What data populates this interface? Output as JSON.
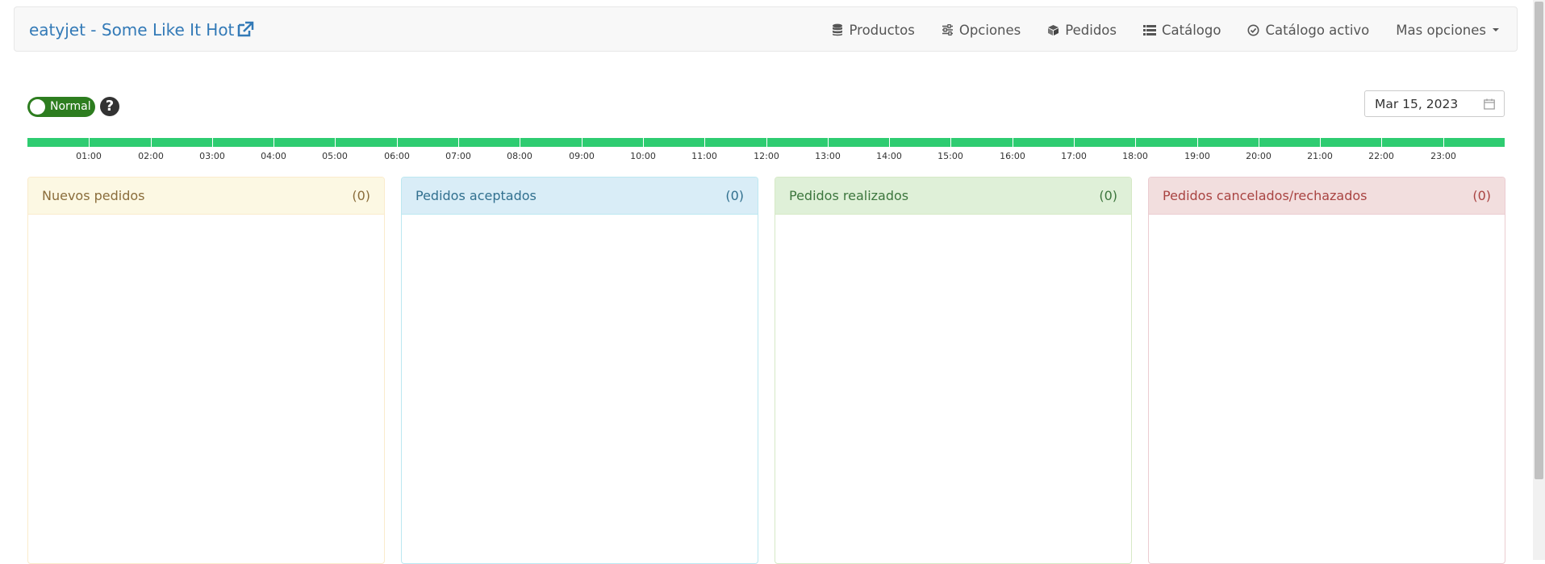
{
  "navbar": {
    "brand": "eatyjet - Some Like It Hot",
    "items": [
      {
        "label": "Productos",
        "icon": "database-icon"
      },
      {
        "label": "Opciones",
        "icon": "sliders-icon"
      },
      {
        "label": "Pedidos",
        "icon": "cube-icon"
      },
      {
        "label": "Catálogo",
        "icon": "list-icon"
      },
      {
        "label": "Catálogo activo",
        "icon": "check-circle-icon"
      },
      {
        "label": "Mas opciones",
        "icon": "caret-down-icon"
      }
    ]
  },
  "mode_toggle": {
    "label": "Normal",
    "state": "on"
  },
  "date_picker": {
    "value": "Mar 15, 2023"
  },
  "timeline": {
    "hours": [
      "01:00",
      "02:00",
      "03:00",
      "04:00",
      "05:00",
      "06:00",
      "07:00",
      "08:00",
      "09:00",
      "10:00",
      "11:00",
      "12:00",
      "13:00",
      "14:00",
      "15:00",
      "16:00",
      "17:00",
      "18:00",
      "19:00",
      "20:00",
      "21:00",
      "22:00",
      "23:00"
    ],
    "color": "#2ecc71"
  },
  "panels": [
    {
      "title": "Nuevos pedidos",
      "count": "(0)"
    },
    {
      "title": "Pedidos aceptados",
      "count": "(0)"
    },
    {
      "title": "Pedidos realizados",
      "count": "(0)"
    },
    {
      "title": "Pedidos cancelados/rechazados",
      "count": "(0)"
    }
  ]
}
